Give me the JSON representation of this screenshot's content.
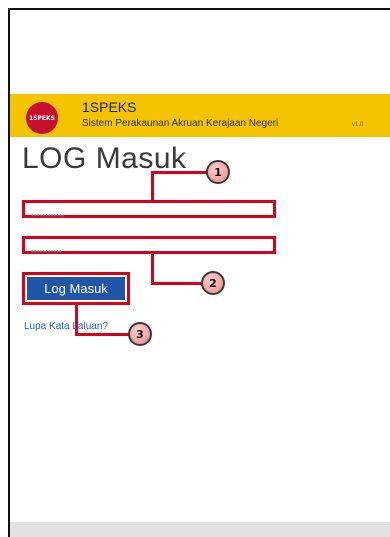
{
  "header": {
    "logo_text": "1SPEKS",
    "app_name": "1SPEKS",
    "app_subtitle": "Sistem Perakaunan Akruan Kerajaan Negeri",
    "version": "v1.0"
  },
  "login": {
    "title": "LOG Masuk",
    "username_value": "••••••••••••",
    "password_value": "•••••••••••",
    "submit_label": "Log Masuk",
    "forgot_label": "Lupa Kata Laluan?"
  },
  "callouts": [
    "1",
    "2",
    "3"
  ],
  "colors": {
    "header_band": "#f5c400",
    "logo": "#c8102e",
    "highlight": "#d9001b",
    "button": "#1f56a8",
    "link": "#1a62c9"
  }
}
